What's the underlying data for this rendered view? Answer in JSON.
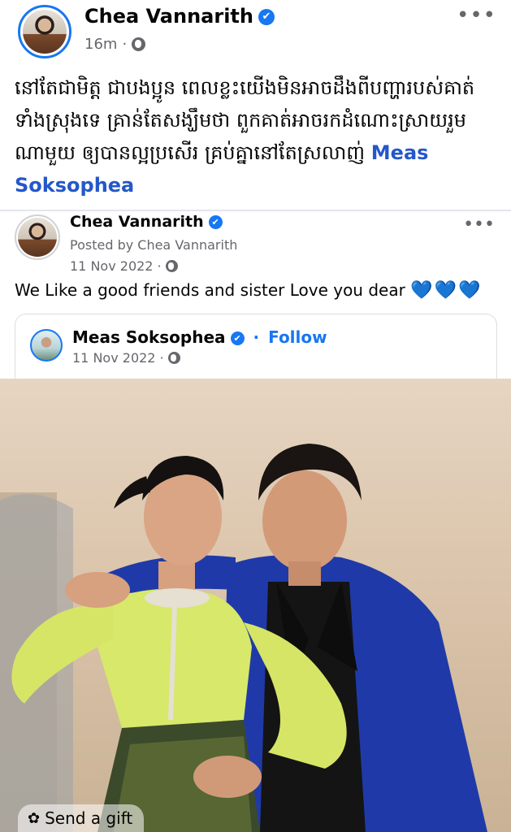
{
  "post": {
    "author": "Chea Vannarith",
    "time": "16m",
    "separator": "·",
    "text": "នៅតែជាមិត្ត ជាបងប្អូន ពេលខ្លះយើងមិនអាចដឹងពីបញ្ហារបស់គាត់ទាំងស្រុងទេ គ្រាន់តែសង្ឃឹមថា ពួកគាត់អាចរកដំណោះស្រាយរួមណាមួយ ឲ្យបានល្អប្រសើរ គ្រប់គ្នានៅតែស្រលាញ់",
    "mention": "Meas Soksophea",
    "more": "•••"
  },
  "shared": {
    "author": "Chea Vannarith",
    "posted_by": "Posted by Chea Vannarith",
    "date": "11 Nov 2022",
    "separator": "·",
    "text": "We Like a good friends and sister Love you dear",
    "hearts": "💙💙💙",
    "more": "•••"
  },
  "embed": {
    "author": "Meas Soksophea",
    "follow_prefix": "·",
    "follow": "Follow",
    "date": "11 Nov 2022",
    "separator": "·"
  },
  "gift": {
    "label": "Send a gift"
  },
  "icons": {
    "verified": "verified-badge-icon",
    "globe": "globe-icon",
    "gift": "gift-icon"
  },
  "colors": {
    "brand": "#1877f2",
    "mention": "#2458c9",
    "meta": "#65676b"
  }
}
